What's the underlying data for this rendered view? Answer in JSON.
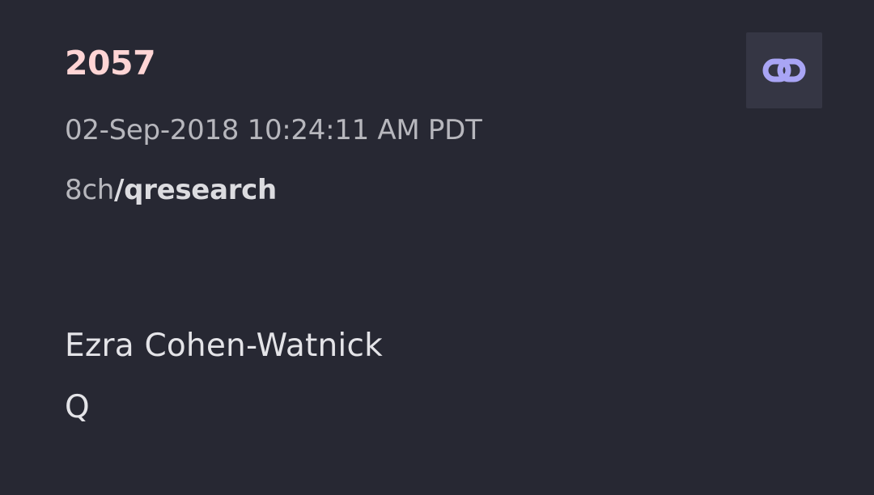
{
  "post": {
    "number": "2057",
    "timestamp": "02-Sep-2018 10:24:11 AM PDT",
    "site": "8ch",
    "separator": "/",
    "board": "qresearch",
    "body_lines": [
      "Ezra Cohen-Watnick",
      "Q"
    ]
  },
  "actions": {
    "link_icon": "chain-link-icon",
    "link_color": "#a9a5f5"
  },
  "colors": {
    "background": "#272833",
    "post_number": "#ffd5d5",
    "meta_text": "#b7b7bd",
    "body_text": "#e4e4e8",
    "button_background": "#353644"
  }
}
